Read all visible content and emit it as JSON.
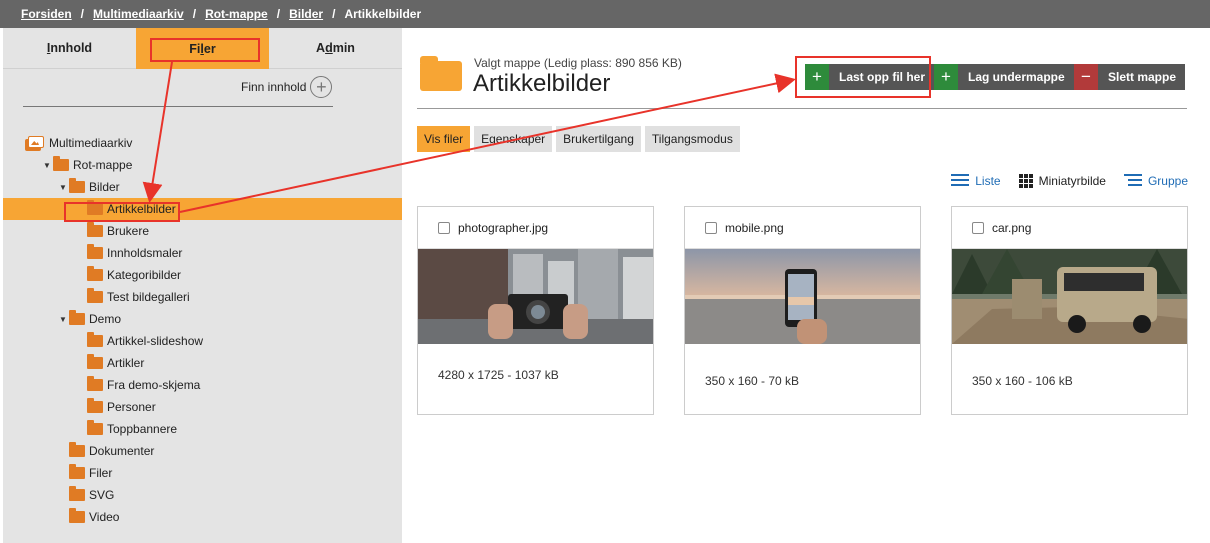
{
  "breadcrumb": {
    "items": [
      "Forsiden",
      "Multimediaarkiv",
      "Rot-mappe",
      "Bilder"
    ],
    "current": "Artikkelbilder"
  },
  "sidebar": {
    "tabs": [
      {
        "pre": "",
        "ul": "I",
        "post": "nnhold"
      },
      {
        "pre": "Fi",
        "ul": "l",
        "post": "er"
      },
      {
        "pre": "A",
        "ul": "d",
        "post": "min"
      }
    ],
    "finn_label": "Finn innhold",
    "tree": [
      {
        "label": "Multimediaarkiv",
        "level": 0,
        "icon": "archive-icon"
      },
      {
        "label": "Rot-mappe",
        "level": 1,
        "caret": true
      },
      {
        "label": "Bilder",
        "level": 2,
        "caret": true
      },
      {
        "label": "Artikkelbilder",
        "level": 3,
        "selected": true
      },
      {
        "label": "Brukere",
        "level": 3
      },
      {
        "label": "Innholdsmaler",
        "level": 3
      },
      {
        "label": "Kategoribilder",
        "level": 3
      },
      {
        "label": "Test bildegalleri",
        "level": 3
      },
      {
        "label": "Demo",
        "level": 2,
        "caret": true
      },
      {
        "label": "Artikkel-slideshow",
        "level": 3
      },
      {
        "label": "Artikler",
        "level": 3
      },
      {
        "label": "Fra demo-skjema",
        "level": 3
      },
      {
        "label": "Personer",
        "level": 3
      },
      {
        "label": "Toppbannere",
        "level": 3
      },
      {
        "label": "Dokumenter",
        "level": 2
      },
      {
        "label": "Filer",
        "level": 2
      },
      {
        "label": "SVG",
        "level": 2
      },
      {
        "label": "Video",
        "level": 2
      }
    ]
  },
  "main": {
    "subtitle": "Valgt mappe (Ledig plass: 890 856 KB)",
    "title": "Artikkelbilder",
    "buttons": {
      "upload": "Last opp fil her",
      "subfolder": "Lag undermappe",
      "delete": "Slett mappe"
    },
    "subtabs": [
      "Vis filer",
      "Egenskaper",
      "Brukertilgang",
      "Tilgangsmodus"
    ],
    "views": {
      "list": "Liste",
      "thumb": "Miniatyrbilde",
      "group": "Gruppe"
    },
    "files": [
      {
        "name": "photographer.jpg",
        "meta": "4280 x 1725 - 1037 kB"
      },
      {
        "name": "mobile.png",
        "meta": "350 x 160 - 70 kB"
      },
      {
        "name": "car.png",
        "meta": "350 x 160 - 106 kB"
      }
    ]
  },
  "colors": {
    "accent": "#f7a534",
    "folder": "#e07b24",
    "annotation": "#e8332a",
    "link": "#1f6cb5"
  }
}
